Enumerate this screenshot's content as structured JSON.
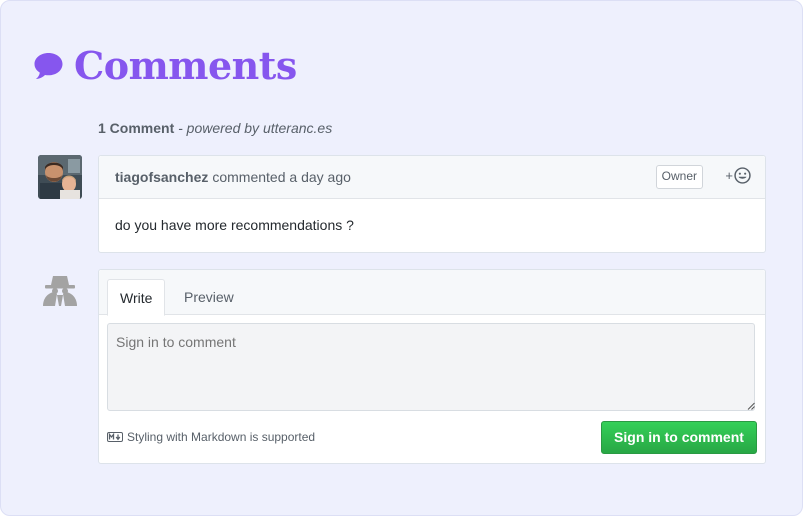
{
  "heading": {
    "title": "Comments",
    "icon": "speech-bubble-icon",
    "color": "#8656ee"
  },
  "summary": {
    "count": "1 Comment",
    "powered_by": " - powered by utteranc.es"
  },
  "comment": {
    "author": "tiagofsanchez",
    "meta": "commented a day ago",
    "badge": "Owner",
    "reaction_plus": "+",
    "reaction_icon": "smiley-icon",
    "body": "do you have more recommendations ?"
  },
  "editor": {
    "tabs": [
      "Write",
      "Preview"
    ],
    "placeholder": "Sign in to comment",
    "markdown_note": "Styling with Markdown is supported",
    "markdown_icon": "markdown-icon",
    "submit_label": "Sign in to comment",
    "submit_color": "#2ea44f"
  }
}
